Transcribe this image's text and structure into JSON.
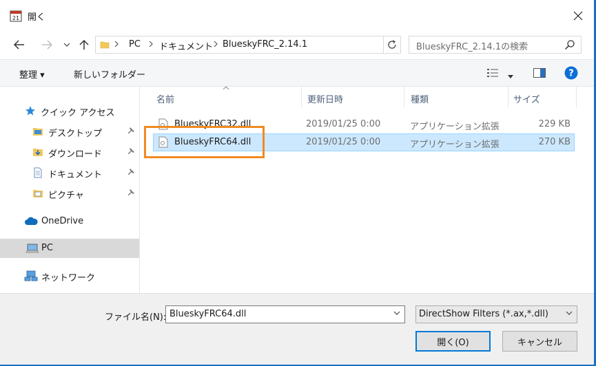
{
  "window": {
    "title": "開く"
  },
  "address": {
    "crumbs": [
      "PC",
      "ドキュメント",
      "BlueskyFRC_2.14.1"
    ]
  },
  "search": {
    "placeholder": "BlueskyFRC_2.14.1の検索"
  },
  "toolbar": {
    "organize_label": "整理 ▾",
    "new_folder_label": "新しいフォルダー"
  },
  "sidebar": {
    "quick_access": "クイック アクセス",
    "items": [
      {
        "label": "デスクトップ",
        "icon": "folder-desktop-icon",
        "pinned": true
      },
      {
        "label": "ダウンロード",
        "icon": "download-folder-icon",
        "pinned": true
      },
      {
        "label": "ドキュメント",
        "icon": "documents-icon",
        "pinned": true
      },
      {
        "label": "ピクチャ",
        "icon": "pictures-folder-icon",
        "pinned": true
      }
    ],
    "onedrive": "OneDrive",
    "pc": "PC",
    "network": "ネットワーク"
  },
  "columns": {
    "name": "名前",
    "date": "更新日時",
    "type": "種類",
    "size": "サイズ"
  },
  "files": [
    {
      "name": "BlueskyFRC32.dll",
      "date": "2019/01/25 0:00",
      "type": "アプリケーション拡張",
      "size": "229 KB",
      "selected": false
    },
    {
      "name": "BlueskyFRC64.dll",
      "date": "2019/01/25 0:00",
      "type": "アプリケーション拡張",
      "size": "270 KB",
      "selected": true
    }
  ],
  "footer": {
    "filename_label": "ファイル名(N):",
    "filename_value": "BlueskyFRC64.dll",
    "filetype_value": "DirectShow Filters (*.ax,*.dll)",
    "open_label": "開く(O)",
    "cancel_label": "キャンセル"
  },
  "colors": {
    "accent": "#0078d7",
    "selection": "#cce8ff",
    "highlight_box": "#f08a24",
    "background_desktop": "#1a6fbf"
  }
}
